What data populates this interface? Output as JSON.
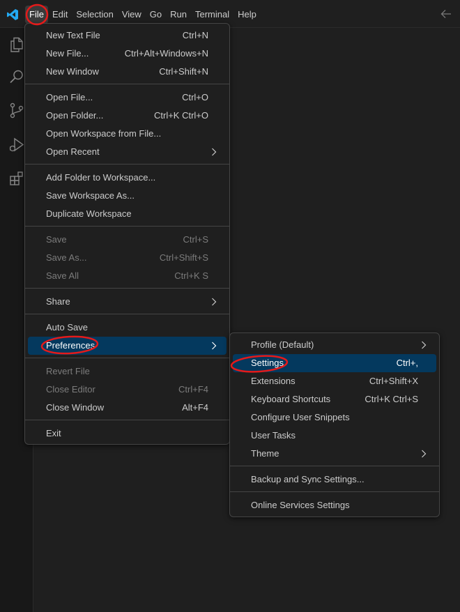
{
  "menubar": {
    "items": [
      "File",
      "Edit",
      "Selection",
      "View",
      "Go",
      "Run",
      "Terminal",
      "Help"
    ]
  },
  "file_menu": {
    "new_text_file": {
      "label": "New Text File",
      "shortcut": "Ctrl+N"
    },
    "new_file": {
      "label": "New File...",
      "shortcut": "Ctrl+Alt+Windows+N"
    },
    "new_window": {
      "label": "New Window",
      "shortcut": "Ctrl+Shift+N"
    },
    "open_file": {
      "label": "Open File...",
      "shortcut": "Ctrl+O"
    },
    "open_folder": {
      "label": "Open Folder...",
      "shortcut": "Ctrl+K Ctrl+O"
    },
    "open_workspace": {
      "label": "Open Workspace from File..."
    },
    "open_recent": {
      "label": "Open Recent"
    },
    "add_folder": {
      "label": "Add Folder to Workspace..."
    },
    "save_workspace_as": {
      "label": "Save Workspace As..."
    },
    "duplicate_workspace": {
      "label": "Duplicate Workspace"
    },
    "save": {
      "label": "Save",
      "shortcut": "Ctrl+S"
    },
    "save_as": {
      "label": "Save As...",
      "shortcut": "Ctrl+Shift+S"
    },
    "save_all": {
      "label": "Save All",
      "shortcut": "Ctrl+K S"
    },
    "share": {
      "label": "Share"
    },
    "auto_save": {
      "label": "Auto Save"
    },
    "preferences": {
      "label": "Preferences"
    },
    "revert_file": {
      "label": "Revert File"
    },
    "close_editor": {
      "label": "Close Editor",
      "shortcut": "Ctrl+F4"
    },
    "close_window": {
      "label": "Close Window",
      "shortcut": "Alt+F4"
    },
    "exit": {
      "label": "Exit"
    }
  },
  "preferences_menu": {
    "profile": {
      "label": "Profile (Default)"
    },
    "settings": {
      "label": "Settings",
      "shortcut": "Ctrl+,"
    },
    "extensions": {
      "label": "Extensions",
      "shortcut": "Ctrl+Shift+X"
    },
    "keyboard_shortcuts": {
      "label": "Keyboard Shortcuts",
      "shortcut": "Ctrl+K Ctrl+S"
    },
    "user_snippets": {
      "label": "Configure User Snippets"
    },
    "user_tasks": {
      "label": "User Tasks"
    },
    "theme": {
      "label": "Theme"
    },
    "backup_sync": {
      "label": "Backup and Sync Settings..."
    },
    "online_services": {
      "label": "Online Services Settings"
    }
  },
  "colors": {
    "accent": "#0078d4",
    "selection": "#04395e",
    "annotation": "#e51a1a"
  },
  "icons": [
    "vscode-logo-icon",
    "back-arrow-icon",
    "explorer-icon",
    "search-icon",
    "source-control-icon",
    "run-debug-icon",
    "extensions-icon",
    "chevron-right-icon"
  ]
}
